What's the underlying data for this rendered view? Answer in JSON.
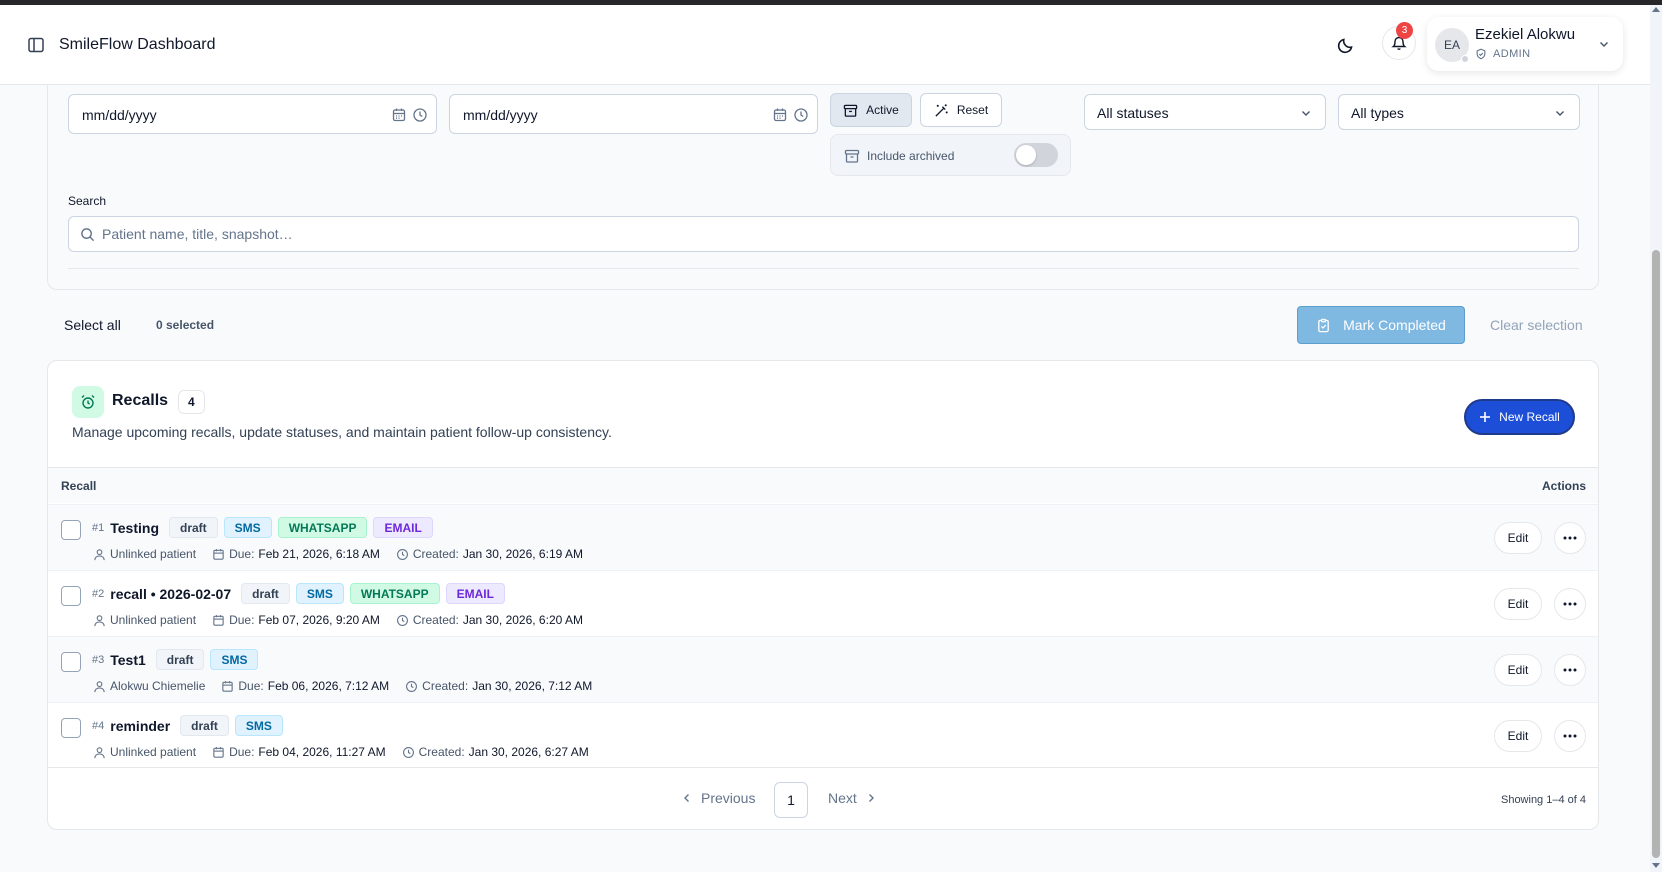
{
  "header": {
    "app_title": "SmileFlow Dashboard",
    "notification_count": "3",
    "user": {
      "initials": "EA",
      "name": "Ezekiel Alokwu",
      "role": "ADMIN"
    }
  },
  "filters": {
    "date_from": {
      "value": "mm/dd/yyyy"
    },
    "date_to": {
      "value": "mm/dd/yyyy"
    },
    "active_label": "Active",
    "reset_label": "Reset",
    "include_archived_label": "Include archived",
    "include_archived": false,
    "status_select": "All statuses",
    "type_select": "All types",
    "search_label": "Search",
    "search_placeholder": "Patient name, title, snapshot…"
  },
  "selection": {
    "select_all_label": "Select all",
    "selected_count": "0 selected",
    "mark_completed_label": "Mark Completed",
    "clear_selection_label": "Clear selection"
  },
  "recalls": {
    "title": "Recalls",
    "count": "4",
    "description": "Manage upcoming recalls, update statuses, and maintain patient follow-up consistency.",
    "new_label": "New Recall",
    "col_recall": "Recall",
    "col_actions": "Actions",
    "rows": [
      {
        "num": "#1",
        "title": "Testing",
        "status": "draft",
        "channels": [
          "SMS",
          "WHATSAPP",
          "EMAIL"
        ],
        "patient": "Unlinked patient",
        "due_label": "Due:",
        "due": "Feb 21, 2026, 6:18 AM",
        "created_label": "Created:",
        "created": "Jan 30, 2026, 6:19 AM"
      },
      {
        "num": "#2",
        "title": "recall • 2026-02-07",
        "status": "draft",
        "channels": [
          "SMS",
          "WHATSAPP",
          "EMAIL"
        ],
        "patient": "Unlinked patient",
        "due_label": "Due:",
        "due": "Feb 07, 2026, 9:20 AM",
        "created_label": "Created:",
        "created": "Jan 30, 2026, 6:20 AM"
      },
      {
        "num": "#3",
        "title": "Test1",
        "status": "draft",
        "channels": [
          "SMS"
        ],
        "patient": "Alokwu Chiemelie",
        "due_label": "Due:",
        "due": "Feb 06, 2026, 7:12 AM",
        "created_label": "Created:",
        "created": "Jan 30, 2026, 7:12 AM"
      },
      {
        "num": "#4",
        "title": "reminder",
        "status": "draft",
        "channels": [
          "SMS"
        ],
        "patient": "Unlinked patient",
        "due_label": "Due:",
        "due": "Feb 04, 2026, 11:27 AM",
        "created_label": "Created:",
        "created": "Jan 30, 2026, 6:27 AM"
      }
    ],
    "edit_label": "Edit",
    "pagination": {
      "prev_label": "Previous",
      "page": "1",
      "next_label": "Next",
      "info": "Showing 1–4 of 4"
    }
  },
  "colors": {
    "accent": "#1d4ed8",
    "mark_completed": "#7fb8e0",
    "badge": "#ef4444"
  }
}
